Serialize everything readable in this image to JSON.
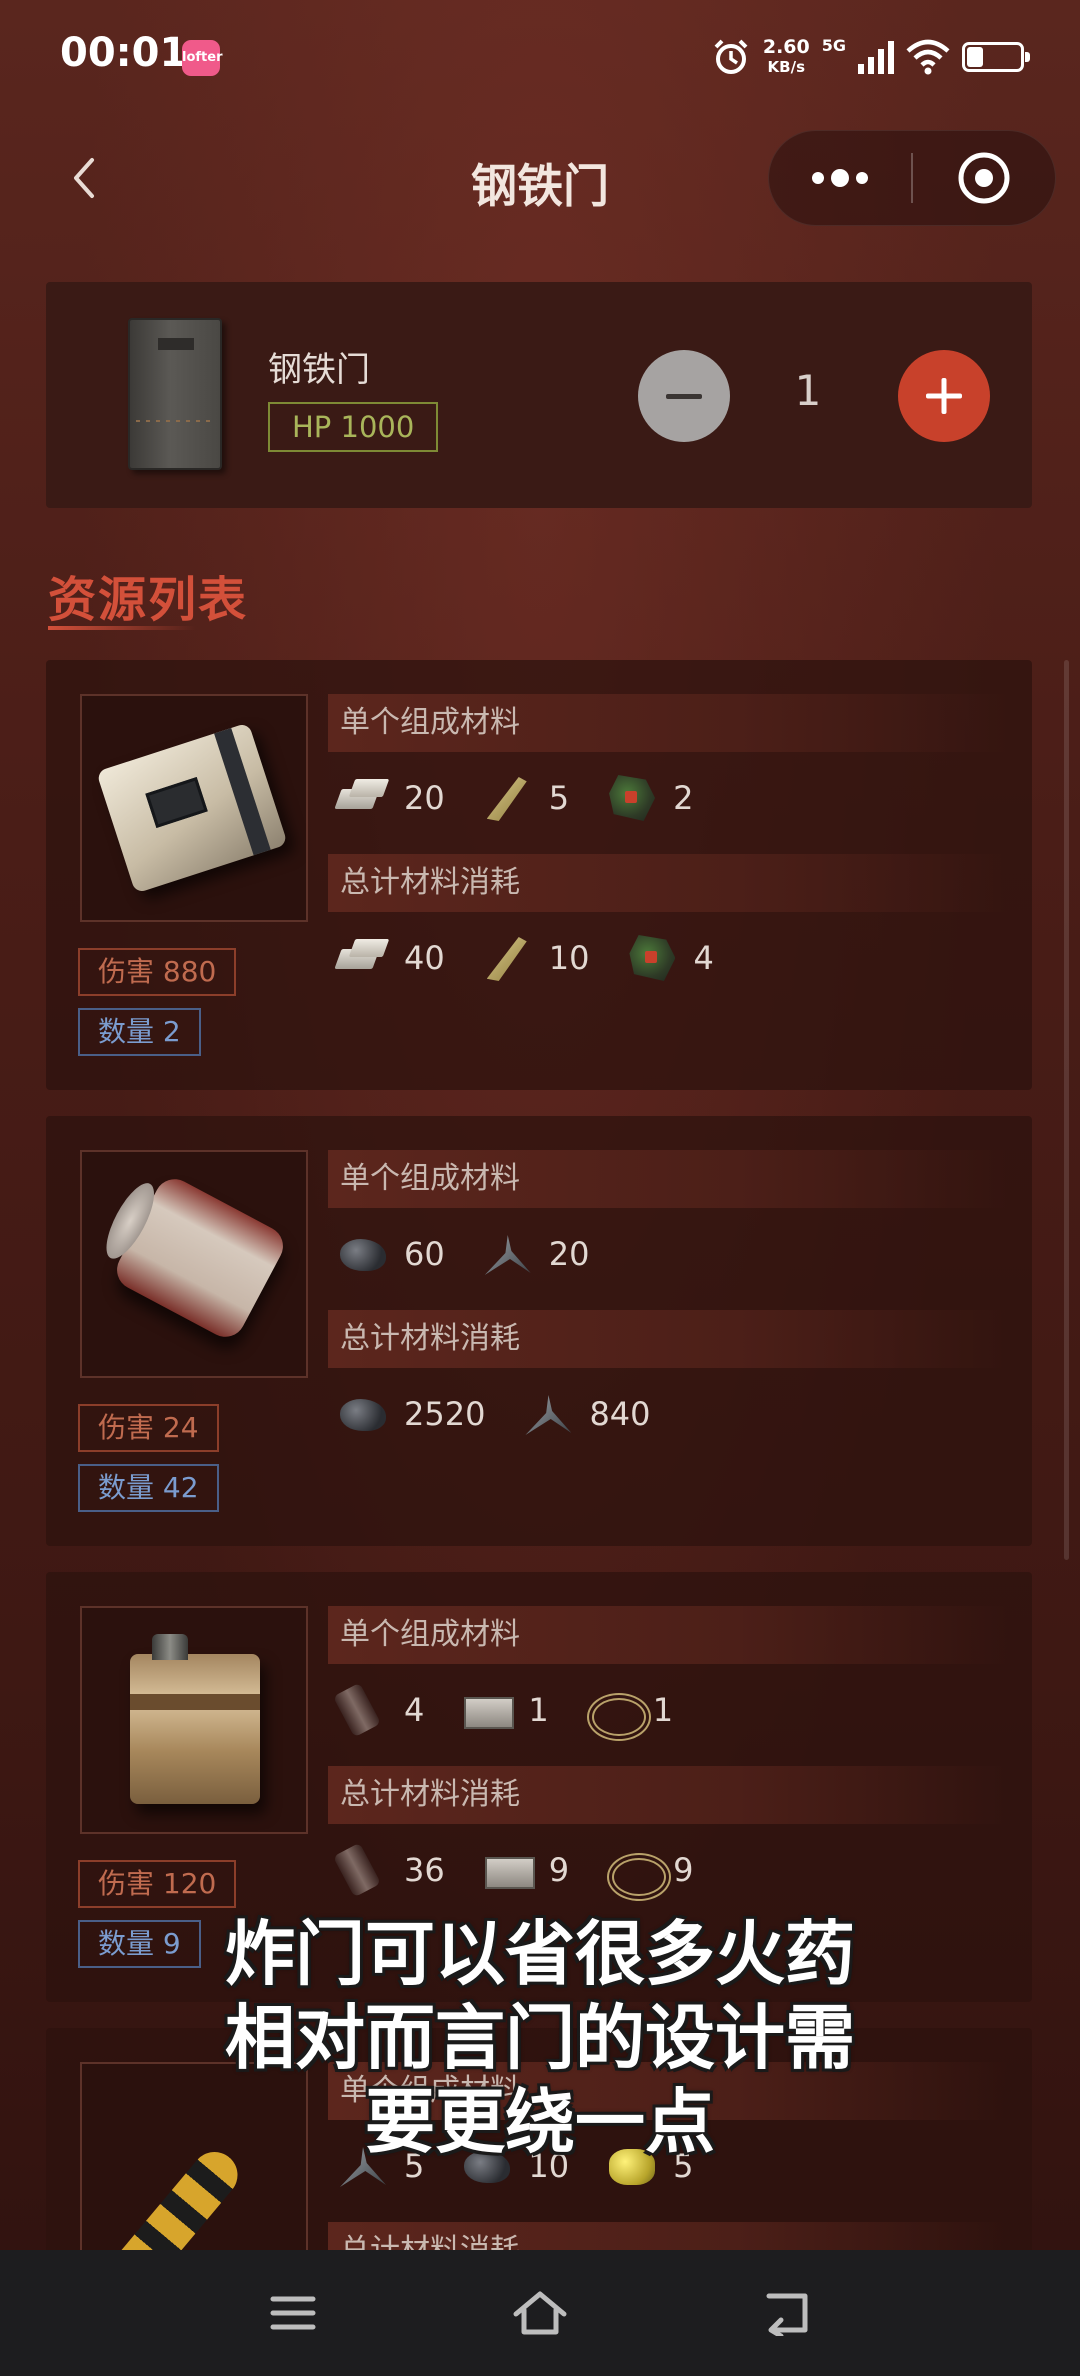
{
  "status_bar": {
    "time": "00:01",
    "app_badge": "lofter",
    "net_speed_value": "2.60",
    "net_speed_unit": "KB/s",
    "network_type": "5G",
    "battery_level": 0.3
  },
  "title_bar": {
    "title": "钢铁门"
  },
  "header": {
    "item_name": "钢铁门",
    "hp": "HP 1000",
    "quantity": "1"
  },
  "section": {
    "title": "资源列表"
  },
  "labels": {
    "single": "单个组成材料",
    "total": "总计材料消耗"
  },
  "resources": [
    {
      "image": "c4-explosive",
      "damage": "伤害 880",
      "count": "数量 2",
      "single": [
        {
          "icon": "metal-fragments-icon",
          "value": "20"
        },
        {
          "icon": "cloth-icon",
          "value": "5"
        },
        {
          "icon": "tech-trash-icon",
          "value": "2"
        }
      ],
      "total": [
        {
          "icon": "metal-fragments-icon",
          "value": "40"
        },
        {
          "icon": "cloth-icon",
          "value": "10"
        },
        {
          "icon": "tech-trash-icon",
          "value": "4"
        }
      ]
    },
    {
      "image": "beancan-grenade",
      "damage": "伤害 24",
      "count": "数量 42",
      "single": [
        {
          "icon": "charcoal-icon",
          "value": "60"
        },
        {
          "icon": "metal-frag-icon",
          "value": "20"
        }
      ],
      "total": [
        {
          "icon": "charcoal-icon",
          "value": "2520"
        },
        {
          "icon": "metal-frag-icon",
          "value": "840"
        }
      ]
    },
    {
      "image": "satchel-charge",
      "damage": "伤害 120",
      "count": "数量 9",
      "single": [
        {
          "icon": "beancan-icon",
          "value": "4"
        },
        {
          "icon": "small-stash-icon",
          "value": "1"
        },
        {
          "icon": "rope-icon",
          "value": "1"
        }
      ],
      "total": [
        {
          "icon": "beancan-icon",
          "value": "36"
        },
        {
          "icon": "small-stash-icon",
          "value": "9"
        },
        {
          "icon": "rope-icon",
          "value": "9"
        }
      ]
    },
    {
      "image": "explosive-ammo",
      "single": [
        {
          "icon": "metal-frag-icon",
          "value": "5"
        },
        {
          "icon": "charcoal-icon",
          "value": "10"
        },
        {
          "icon": "sulfur-icon",
          "value": "5"
        }
      ]
    }
  ],
  "subtitles": {
    "line1": "炸门可以省很多火药",
    "line2": "相对而言门的设计需",
    "line3": "要更绕一点"
  }
}
